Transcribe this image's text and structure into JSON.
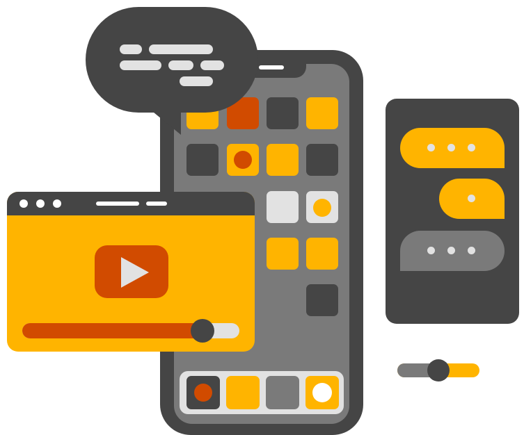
{
  "colors": {
    "dark": "#454545",
    "gray": "#7a7a7a",
    "light": "#e2e2e2",
    "yellow": "#ffb400",
    "orange": "#d14b00",
    "white": "#ffffff"
  },
  "video_player": {
    "play_icon": "play-icon",
    "progress": 0.83
  },
  "slider": {
    "level": 0.5
  },
  "phone": {
    "home_indicator": "notch-bar"
  }
}
